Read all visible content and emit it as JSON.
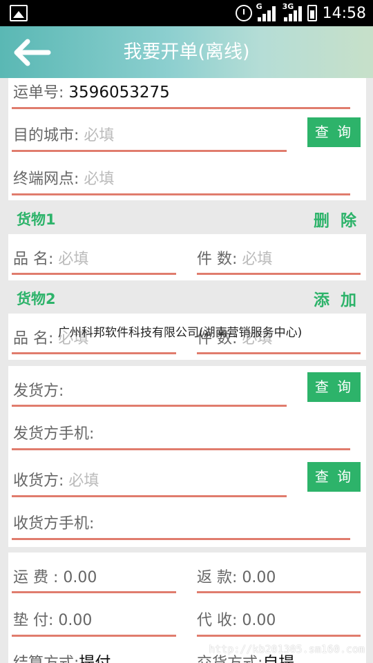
{
  "status_bar": {
    "time": "14:58",
    "net1": "G",
    "net2": "3G"
  },
  "header": {
    "title": "我要开单(离线)"
  },
  "waybill": {
    "number_label": "运单号:",
    "number_value": "3596053275",
    "city_label": "目的城市:",
    "city_placeholder": "必填",
    "query_label": "查 询",
    "terminal_label": "终端网点:",
    "terminal_placeholder": "必填"
  },
  "goods1": {
    "title": "货物1",
    "action": "删 除",
    "name_label": "品  名:",
    "name_placeholder": "必填",
    "count_label": "件  数:",
    "count_placeholder": "必填"
  },
  "goods2": {
    "title": "货物2",
    "action": "添 加",
    "name_label": "品  名:",
    "name_placeholder": "必填",
    "count_label": "件  数:",
    "count_placeholder": "必填"
  },
  "parties": {
    "sender_label": "发货方:",
    "sender_query": "查 询",
    "sender_phone_label": "发货方手机:",
    "receiver_label": "收货方:",
    "receiver_placeholder": "必填",
    "receiver_query": "查 询",
    "receiver_phone_label": "收货方手机:"
  },
  "fees": {
    "freight_label": "运  费 :",
    "freight_value": "0.00",
    "refund_label": "返  款:",
    "refund_value": "0.00",
    "advance_label": "垫  付:",
    "advance_value": "0.00",
    "collect_label": "代  收:",
    "collect_value": "0.00",
    "settle_label": "结算方式:",
    "settle_value": "提付",
    "delivery_label": "交货方式:",
    "delivery_value": "自提"
  },
  "watermark": {
    "company": "广州科邦软件科技有限公司(湖南营销服务中心)",
    "url": "http://kb201305.sm160.com"
  },
  "colors": {
    "accent_green": "#2db36a",
    "underline_red": "#e07c6d",
    "title_teal": "#5ab8b4"
  }
}
